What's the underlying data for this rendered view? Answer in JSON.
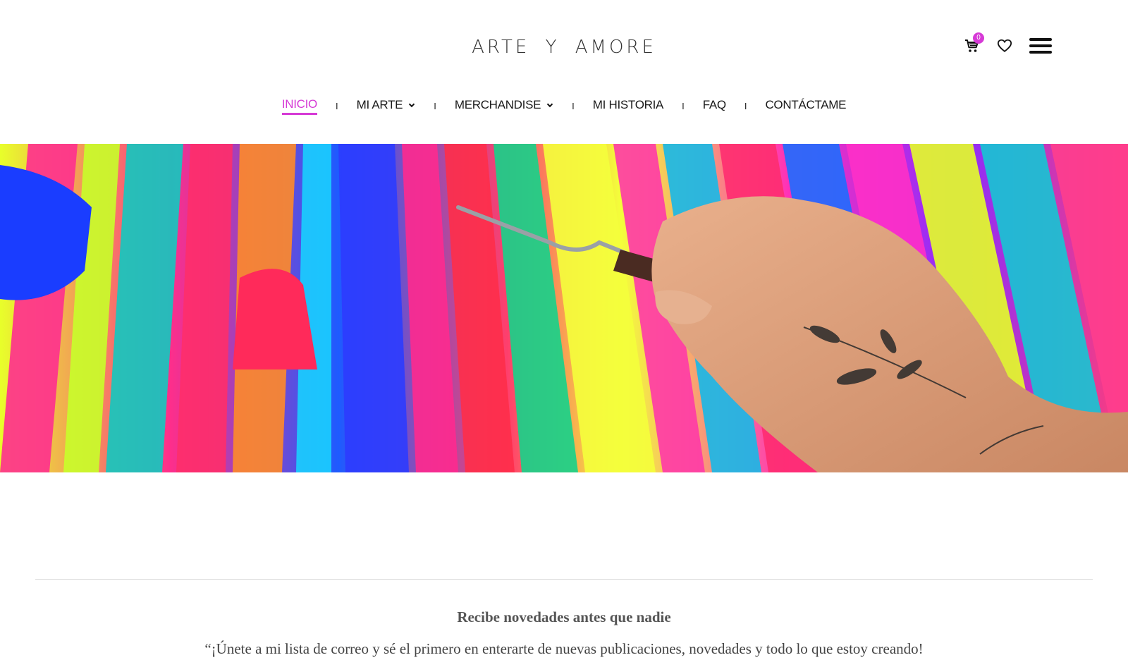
{
  "header": {
    "logo": "ARTE Y AMORE",
    "cart_count": "0",
    "icons": [
      "cart-icon",
      "heart-icon",
      "hamburger-menu-icon"
    ]
  },
  "nav": {
    "items": [
      {
        "label": "INICIO",
        "active": true,
        "dropdown": false
      },
      {
        "label": "MI ARTE",
        "active": false,
        "dropdown": true
      },
      {
        "label": "MERCHANDISE",
        "active": false,
        "dropdown": true
      },
      {
        "label": "MI HISTORIA",
        "active": false,
        "dropdown": false
      },
      {
        "label": "FAQ",
        "active": false,
        "dropdown": false
      },
      {
        "label": "CONTÁCTAME",
        "active": false,
        "dropdown": false
      }
    ],
    "separator": "I"
  },
  "newsletter": {
    "title": "Recibe novedades antes que nadie",
    "text": "“¡Únete a mi lista de correo y sé el primero en enterarte de nuevas publicaciones, novedades y todo lo que estoy creando!"
  },
  "colors": {
    "accent": "#d63ad6",
    "text": "#1a1a1a",
    "divider": "#dcdcdc"
  }
}
